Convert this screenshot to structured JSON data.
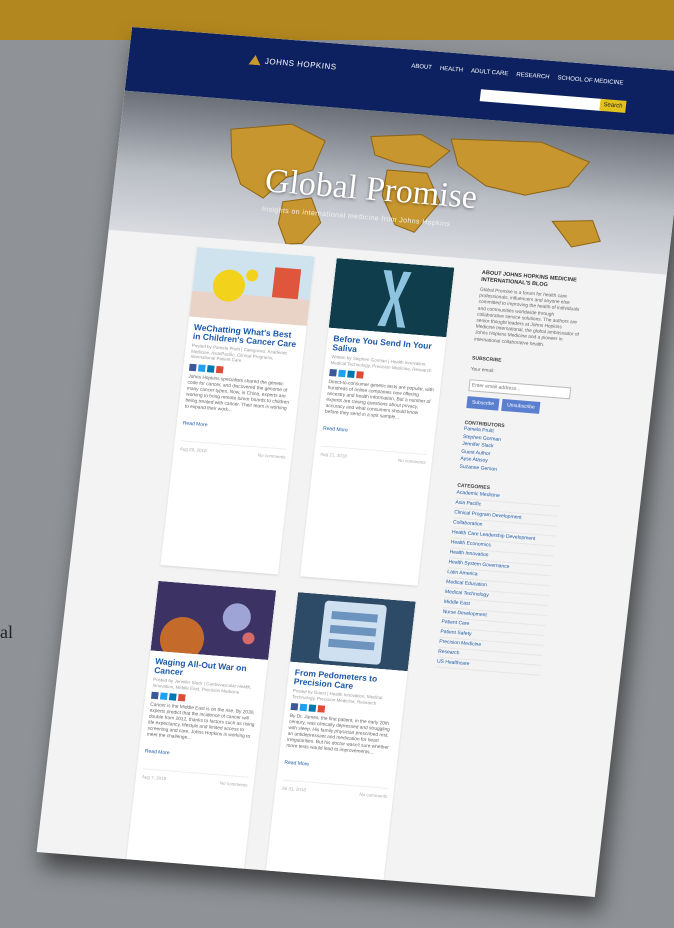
{
  "page": {
    "background_color": "#8f9296",
    "band_color": "#b3871f",
    "edge_text_right": "al"
  },
  "nav": {
    "logo_text": "JOHNS HOPKINS",
    "links": [
      "ABOUT",
      "HEALTH",
      "ADULT CARE",
      "RESEARCH",
      "SCHOOL OF MEDICINE"
    ],
    "search_placeholder": "",
    "search_button": "Search"
  },
  "hero": {
    "title": "Global Promise",
    "subtitle": "Insights on international medicine from Johns Hopkins"
  },
  "posts": [
    {
      "title": "WeChatting What's Best in Children's Cancer Care",
      "meta": "Posted by Pamela Pruitt | Categories: Academic Medicine, Asia/Pacific, Clinical Programs, International Patient Care",
      "excerpt": "Johns Hopkins specialists shared the genetic code for cancer, and discovered the genome of many cancer types. Now, in China, experts are working to bring remote tumor boards to children being treated with cancer. Their team is working to expand their work...",
      "read_more": "Read More",
      "date": "Aug 29, 2018",
      "comments": "No comments"
    },
    {
      "title": "Before You Send In Your Saliva",
      "meta": "Written by Stephen Gorman | Health Innovation, Medical Technology, Precision Medicine, Research",
      "excerpt": "Direct-to-consumer genetic tests are popular, with hundreds of online companies now offering ancestry and health information. But a number of experts are raising questions about privacy, accuracy and what consumers should know before they send in a spit sample...",
      "read_more": "Read More",
      "date": "Aug 21, 2018",
      "comments": "No comments"
    },
    {
      "title": "Waging All-Out War on Cancer",
      "meta": "Posted by Jennifer Slack | Cardiovascular Health, Innovation, Middle East, Precision Medicine",
      "excerpt": "Cancer is the Middle East is on the rise. By 2030, experts predict that the incidence of cancer will double from 2012, thanks to factors such as rising life expectancy, lifestyle and limited access to screening and care. Johns Hopkins is working to meet the challenge...",
      "read_more": "Read More",
      "date": "Aug 7, 2018",
      "comments": "No comments"
    },
    {
      "title": "From Pedometers to Precision Care",
      "meta": "Posted by Guest | Health Innovation, Medical Technology, Precision Medicine, Research",
      "excerpt": "By Dr. James, the first patient, in the early 20th century, was clinically depressed and struggling with sleep. His family physician prescribed rest, an antidepressant and medication for heart irregularities. But his doctor wasn't sure whether more tests would lead to improvements...",
      "read_more": "Read More",
      "date": "Jul 31, 2018",
      "comments": "No comments"
    }
  ],
  "sidebar": {
    "about_heading": "ABOUT JOHNS HOPKINS MEDICINE INTERNATIONAL'S BLOG",
    "about_text": "Global Promise is a forum for health care professionals, influencers and anyone else committed to improving the health of individuals and communities worldwide through collaborative service solutions. The authors are senior thought leaders at Johns Hopkins Medicine International, the global ambassador of Johns Hopkins Medicine and a pioneer in international collaborative health.",
    "subscribe_heading": "SUBSCRIBE",
    "email_label": "Your email:",
    "email_placeholder": "Enter email address...",
    "subscribe_button": "Subscribe",
    "unsubscribe_button": "Unsubscribe",
    "contributors_heading": "CONTRIBUTORS",
    "contributors": [
      "Pamela Pruitt",
      "Stephen Gorman",
      "Jennifer Slack",
      "Guest Author",
      "Ayse Atasoy",
      "Suzanne Gerson"
    ],
    "categories_heading": "CATEGORIES",
    "categories": [
      "Academic Medicine",
      "Asia Pacific",
      "Clinical Program Development",
      "Collaboration",
      "Health Care Leadership Development",
      "Health Economics",
      "Health Innovation",
      "Health System Governance",
      "Latin America",
      "Medical Education",
      "Medical Technology",
      "Middle East",
      "Nurse Development",
      "Patient Care",
      "Patient Safety",
      "Precision Medicine",
      "Research",
      "US Healthcare"
    ]
  },
  "share_colors": [
    "#3b5998",
    "#1da1f2",
    "#0077b5",
    "#dd4b39"
  ]
}
